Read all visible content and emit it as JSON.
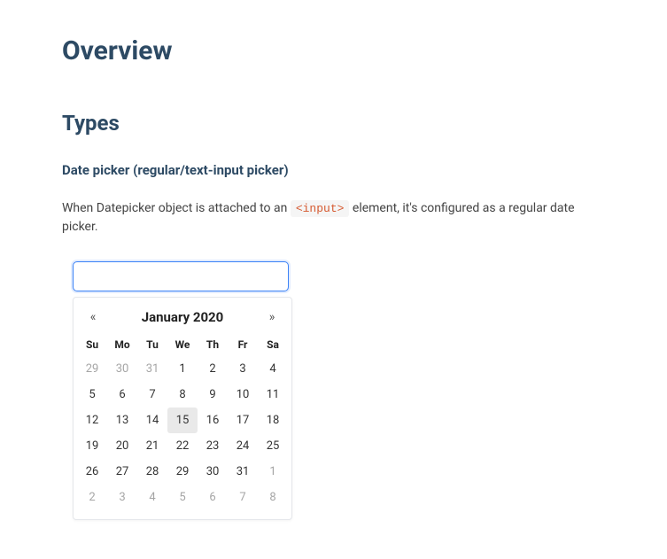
{
  "headings": {
    "overview": "Overview",
    "types": "Types",
    "sub": "Date picker (regular/text-input picker)"
  },
  "paragraph": {
    "pre": "When Datepicker object is attached to an ",
    "code": "<input>",
    "post": " element, it's configured as a regular date picker."
  },
  "input": {
    "value": "",
    "placeholder": ""
  },
  "calendar": {
    "title": "January 2020",
    "prev_glyph": "«",
    "next_glyph": "»",
    "dow": [
      "Su",
      "Mo",
      "Tu",
      "We",
      "Th",
      "Fr",
      "Sa"
    ],
    "weeks": [
      [
        {
          "d": "29",
          "out": true
        },
        {
          "d": "30",
          "out": true
        },
        {
          "d": "31",
          "out": true
        },
        {
          "d": "1"
        },
        {
          "d": "2"
        },
        {
          "d": "3"
        },
        {
          "d": "4"
        }
      ],
      [
        {
          "d": "5"
        },
        {
          "d": "6"
        },
        {
          "d": "7"
        },
        {
          "d": "8"
        },
        {
          "d": "9"
        },
        {
          "d": "10"
        },
        {
          "d": "11"
        }
      ],
      [
        {
          "d": "12"
        },
        {
          "d": "13"
        },
        {
          "d": "14"
        },
        {
          "d": "15",
          "focused": true
        },
        {
          "d": "16"
        },
        {
          "d": "17"
        },
        {
          "d": "18"
        }
      ],
      [
        {
          "d": "19"
        },
        {
          "d": "20"
        },
        {
          "d": "21"
        },
        {
          "d": "22"
        },
        {
          "d": "23"
        },
        {
          "d": "24"
        },
        {
          "d": "25"
        }
      ],
      [
        {
          "d": "26"
        },
        {
          "d": "27"
        },
        {
          "d": "28"
        },
        {
          "d": "29"
        },
        {
          "d": "30"
        },
        {
          "d": "31"
        },
        {
          "d": "1",
          "out": true
        }
      ],
      [
        {
          "d": "2",
          "out": true
        },
        {
          "d": "3",
          "out": true
        },
        {
          "d": "4",
          "out": true
        },
        {
          "d": "5",
          "out": true
        },
        {
          "d": "6",
          "out": true
        },
        {
          "d": "7",
          "out": true
        },
        {
          "d": "8",
          "out": true
        }
      ]
    ]
  }
}
